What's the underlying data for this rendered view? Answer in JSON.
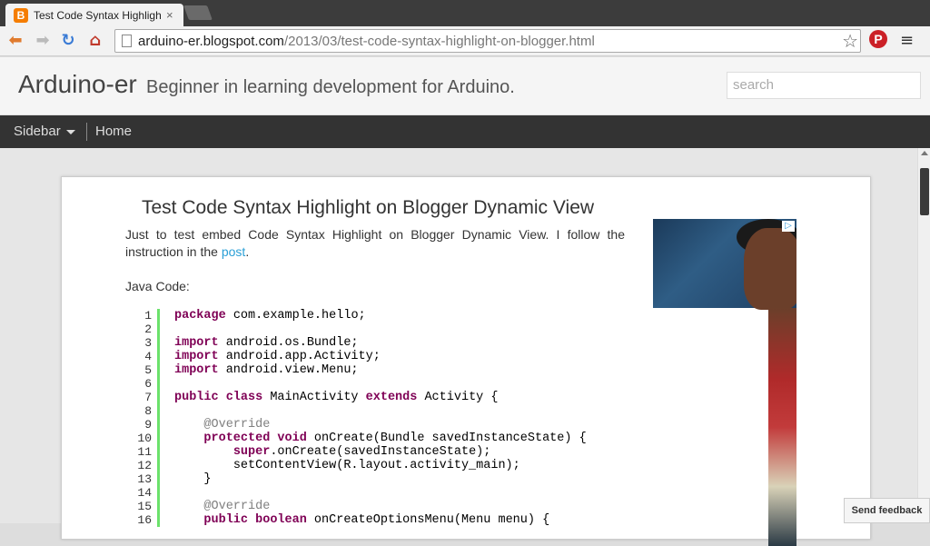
{
  "browser": {
    "tab_title": "Test Code Syntax Highligh",
    "tab_close": "×",
    "url_host": "arduino-er.blogspot.com",
    "url_path": "/2013/03/test-code-syntax-highlight-on-blogger.html"
  },
  "icons": {
    "favicon": "blogger-icon",
    "back": "back-arrow-icon",
    "forward": "forward-arrow-icon",
    "reload": "reload-icon",
    "home": "home-icon",
    "bookmark": "star-icon",
    "pinterest": "pinterest-icon",
    "menu": "menu-icon"
  },
  "blog": {
    "title": "Arduino-er",
    "description": "Beginner in learning development for Arduino.",
    "search_placeholder": "search"
  },
  "nav": {
    "sidebar_label": "Sidebar",
    "home_label": "Home"
  },
  "post": {
    "title": "Test Code Syntax Highlight on Blogger Dynamic View",
    "intro_text": "Just to test embed Code Syntax Highlight on Blogger Dynamic View. I follow the instruction in the",
    "intro_link": "post",
    "intro_end": ".",
    "java_label": "Java Code:",
    "code_lines": [
      {
        "n": "1",
        "kw": "package",
        "rest": " com.example.hello;",
        "indent": ""
      },
      {
        "n": "2",
        "kw": "",
        "rest": "",
        "indent": ""
      },
      {
        "n": "3",
        "kw": "import",
        "rest": " android.os.Bundle;",
        "indent": ""
      },
      {
        "n": "4",
        "kw": "import",
        "rest": " android.app.Activity;",
        "indent": ""
      },
      {
        "n": "5",
        "kw": "import",
        "rest": " android.view.Menu;",
        "indent": ""
      },
      {
        "n": "6",
        "kw": "",
        "rest": "",
        "indent": ""
      },
      {
        "n": "7",
        "kw": "public class",
        "rest": " MainActivity ",
        "kw2": "extends",
        "rest2": " Activity {",
        "indent": ""
      },
      {
        "n": "8",
        "kw": "",
        "rest": "",
        "indent": ""
      },
      {
        "n": "9",
        "an": "@Override",
        "indent": "    "
      },
      {
        "n": "10",
        "kw": "protected void",
        "rest": " onCreate(Bundle savedInstanceState) {",
        "indent": "    "
      },
      {
        "n": "11",
        "kw": "super",
        "rest": ".onCreate(savedInstanceState);",
        "indent": "        "
      },
      {
        "n": "12",
        "kw": "",
        "rest": "setContentView(R.layout.activity_main);",
        "indent": "        "
      },
      {
        "n": "13",
        "kw": "",
        "rest": "}",
        "indent": "    "
      },
      {
        "n": "14",
        "kw": "",
        "rest": "",
        "indent": ""
      },
      {
        "n": "15",
        "an": "@Override",
        "indent": "    "
      },
      {
        "n": "16",
        "kw": "public boolean",
        "rest": " onCreateOptionsMenu(Menu menu) {",
        "indent": "    "
      }
    ]
  },
  "ad": {
    "choices_badge": "▷"
  },
  "feedback_label": "Send feedback",
  "colors": {
    "keyword": "#7f0055",
    "annotation": "#808080",
    "gutter_line": "#6ce26c",
    "link": "#2a9fd6",
    "navbar": "#333333"
  }
}
